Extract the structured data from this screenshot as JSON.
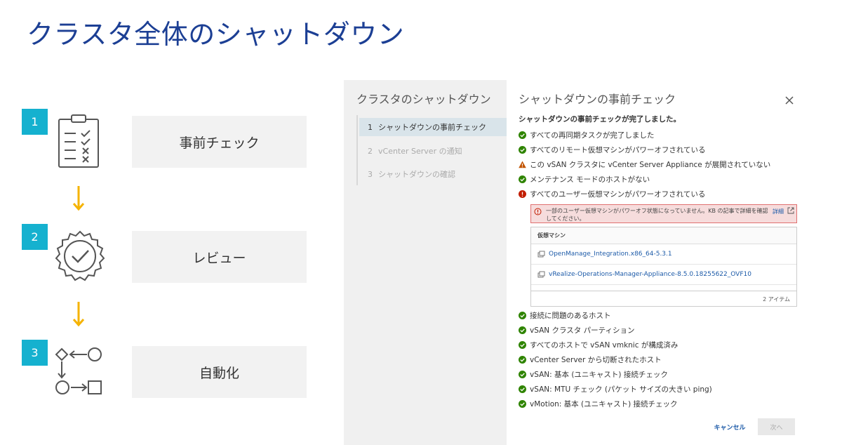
{
  "main_title": "クラスタ全体のシャットダウン",
  "process": {
    "steps": [
      {
        "number": "1",
        "label": "事前チェック",
        "icon": "clipboard-checklist-icon"
      },
      {
        "number": "2",
        "label": "レビュー",
        "icon": "badge-check-icon"
      },
      {
        "number": "3",
        "label": "自動化",
        "icon": "workflow-icon"
      }
    ],
    "arrow_color": "#f5b300",
    "badge_color": "#15b1cf"
  },
  "wizard": {
    "nav_title": "クラスタのシャットダウン",
    "nav_items": [
      {
        "num": "1",
        "label": "シャットダウンの事前チェック",
        "active": true
      },
      {
        "num": "2",
        "label": "vCenter Server の通知",
        "active": false
      },
      {
        "num": "3",
        "label": "シャットダウンの確認",
        "active": false
      }
    ],
    "dialog_title": "シャットダウンの事前チェック",
    "complete_message": "シャットダウンの事前チェックが完了しました。",
    "checks_top": [
      {
        "status": "ok",
        "text": "すべての再同期タスクが完了しました"
      },
      {
        "status": "ok",
        "text": "すべてのリモート仮想マシンがパワーオフされている"
      },
      {
        "status": "warning",
        "text": "この vSAN クラスタに vCenter Server Appliance が展開されていない"
      },
      {
        "status": "ok",
        "text": "メンテナンス モードのホストがない"
      },
      {
        "status": "error",
        "text": "すべてのユーザー仮想マシンがパワーオフされている"
      }
    ],
    "alert": {
      "text": "一部のユーザー仮想マシンがパワーオフ状態になっていません。KB の記事で詳細を確認してください。",
      "link": "詳細"
    },
    "vm_table": {
      "header": "仮想マシン",
      "rows": [
        "OpenManage_Integration.x86_64-5.3.1",
        "vRealize-Operations-Manager-Appliance-8.5.0.18255622_OVF10"
      ],
      "footer": "2 アイテム"
    },
    "checks_bottom": [
      {
        "status": "ok",
        "text": "接続に問題のあるホスト"
      },
      {
        "status": "ok",
        "text": "vSAN クラスタ パーティション"
      },
      {
        "status": "ok",
        "text": "すべてのホストで vSAN vmknic が構成済み"
      },
      {
        "status": "ok",
        "text": "vCenter Server から切断されたホスト"
      },
      {
        "status": "ok",
        "text": "vSAN: 基本 (ユニキャスト) 接続チェック"
      },
      {
        "status": "ok",
        "text": "vSAN: MTU チェック (パケット サイズの大きい ping)"
      },
      {
        "status": "ok",
        "text": "vMotion: 基本 (ユニキャスト) 接続チェック"
      }
    ],
    "cancel_label": "キャンセル",
    "next_label": "次へ"
  }
}
